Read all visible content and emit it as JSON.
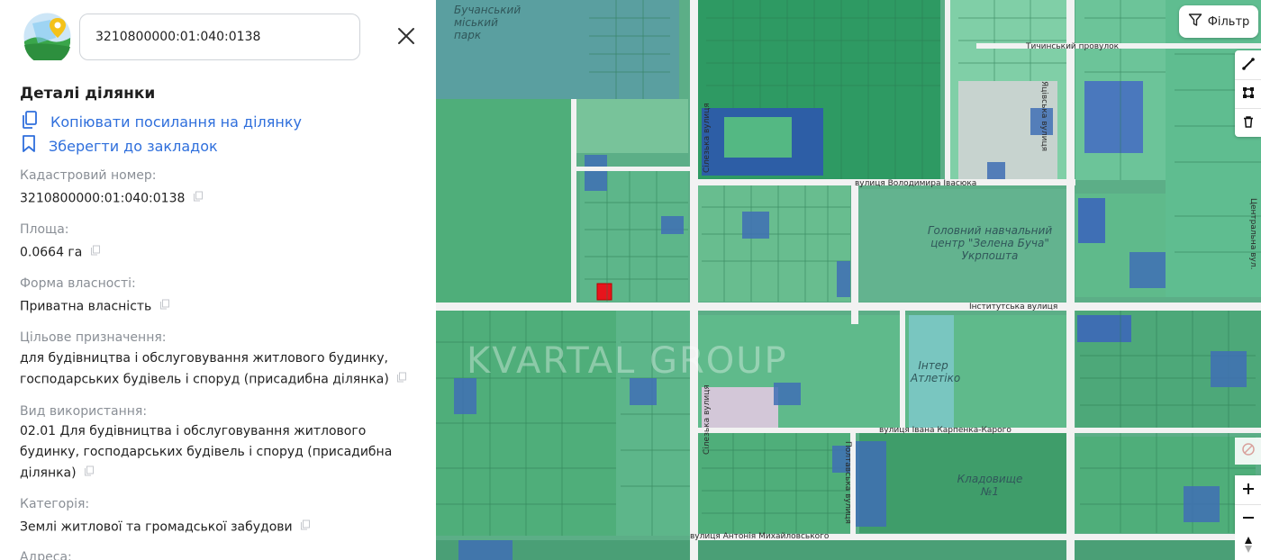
{
  "search": {
    "value": "3210800000:01:040:0138"
  },
  "details": {
    "title": "Деталі ділянки",
    "copy_link_label": "Копіювати посилання на ділянку",
    "bookmark_label": "Зберегти до закладок"
  },
  "fields": {
    "cadastral": {
      "label": "Кадастровий номер:",
      "value": "3210800000:01:040:0138"
    },
    "area": {
      "label": "Площа:",
      "value": "0.0664 га"
    },
    "ownership": {
      "label": "Форма власності:",
      "value": "Приватна власність"
    },
    "purpose": {
      "label": "Цільове призначення:",
      "value": "для будівництва і обслуговування житлового будинку, господарських будівель і споруд (присадибна ділянка)"
    },
    "usage": {
      "label": "Вид використання:",
      "value": "02.01 Для будівництва і обслуговування житлового будинку, господарських будівель і споруд (присадибна ділянка)"
    },
    "category": {
      "label": "Категорія:",
      "value": "Землі житлової та громадської забудови"
    },
    "address": {
      "label": "Адреса:"
    }
  },
  "map": {
    "filter_label": "Фільтр",
    "watermark": "KVARTAL GROUP",
    "labels": {
      "park": "Бучанський міський парк",
      "tychynskyi": "Тичинський провулок",
      "yatsivska": "Яцівська вулиця",
      "ivasiuk": "вулиця Володимира Івасюка",
      "silezka_top": "Сілезька вулиця",
      "silezka_bottom": "Сілезька вулиця",
      "instytutska": "Інститутська вулиця",
      "karpenko": "вулиця Івана Карпенка-Карого",
      "mykhailovskyi": "вулиця Антонія Михайловського",
      "poltavska": "Полтавська вулиця",
      "tsentralna": "Центральна вул.",
      "center": "Головний навчальний центр \"Зелена Буча\" Укрпошта",
      "inter": "Інтер Атлетіко",
      "cemetery": "Кладовище №1"
    },
    "colors": {
      "base": "#5cae87",
      "parcel": "#4fae7a",
      "parcel_dark": "#2f8f5e",
      "parcel_blue": "#4069b0",
      "selected": "#e8141c",
      "road": "#f2f2f2"
    }
  }
}
